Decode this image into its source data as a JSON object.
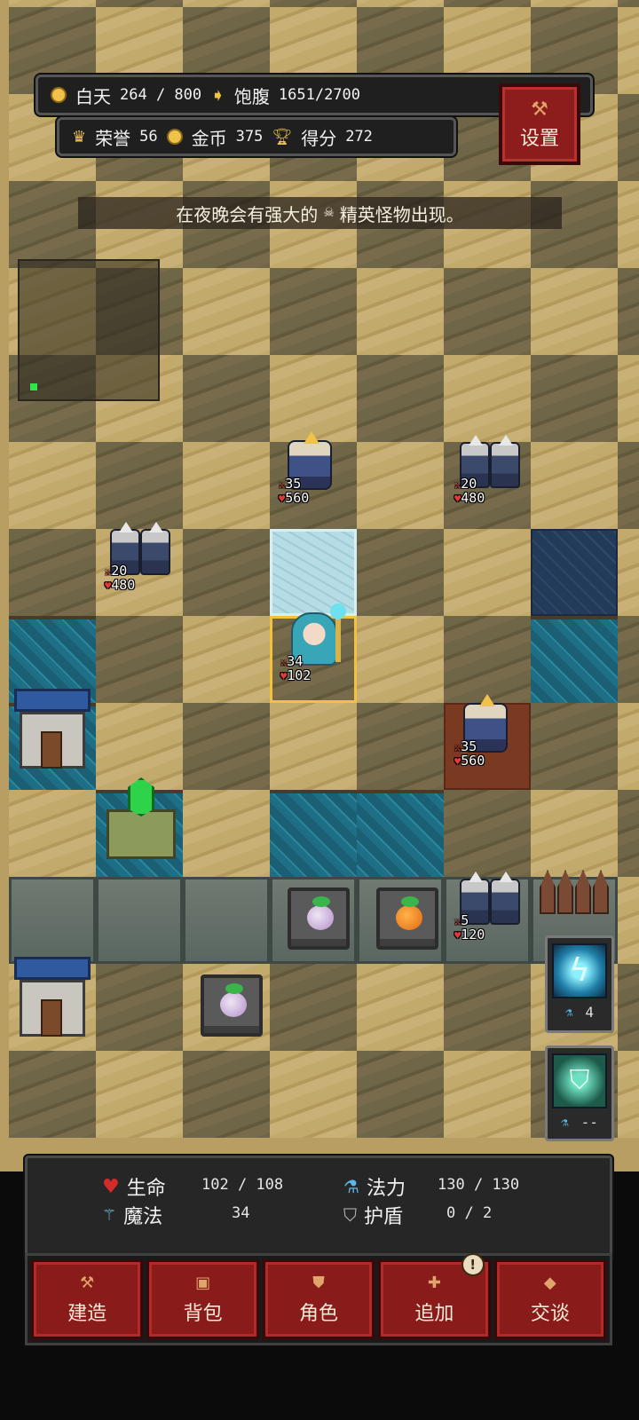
{
  "hud": {
    "day_label": "白天",
    "day_value": "264 / 800",
    "hunger_label": "饱腹",
    "hunger_value": "1651/2700",
    "honor_label": "荣誉",
    "honor_value": "56",
    "gold_label": "金币",
    "gold_value": "375",
    "score_label": "得分",
    "score_value": "272",
    "settings_label": "设置"
  },
  "notice": {
    "text_before": "在夜晚会有强大的",
    "text_after": "精英怪物出现。",
    "skull_icon": "skull-icon"
  },
  "units": [
    {
      "kind": "captain",
      "atk": "35",
      "hp": "560"
    },
    {
      "kind": "knight-pair",
      "atk": "20",
      "hp": "480"
    },
    {
      "kind": "knight-pair",
      "atk": "20",
      "hp": "480"
    },
    {
      "kind": "hero",
      "atk": "34",
      "hp": "102"
    },
    {
      "kind": "captain",
      "atk": "35",
      "hp": "560"
    },
    {
      "kind": "knight-pair",
      "atk": "5",
      "hp": "120"
    }
  ],
  "side_slots": {
    "lightning_cost": "4",
    "shield_cost": "--"
  },
  "stats": {
    "life_label": "生命",
    "life_value": "102 / 108",
    "mana_label": "法力",
    "mana_value": "130 / 130",
    "magic_label": "魔法",
    "magic_value": "34",
    "shield_label": "护盾",
    "shield_value": "0 / 2"
  },
  "menu": {
    "build": "建造",
    "bag": "背包",
    "character": "角色",
    "add": "追加",
    "talk": "交谈",
    "add_badge": "!"
  },
  "colors": {
    "button_red": "#8a1b1b",
    "accent_gold": "#f0c24a",
    "hp_red": "#d42a2a",
    "mana_blue": "#58b8ea",
    "selected_outline": "#f4c23a"
  }
}
